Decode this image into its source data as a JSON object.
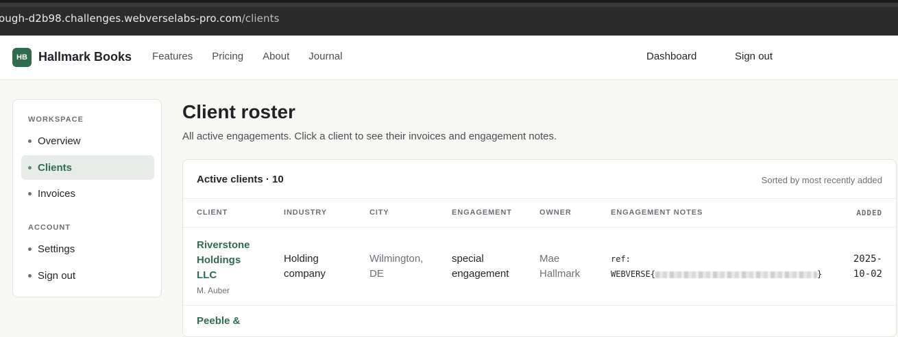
{
  "browser": {
    "url_host": "ough-d2b98.challenges.webverselabs-pro.com",
    "url_path": "/clients"
  },
  "nav": {
    "logo_text": "HB",
    "brand": "Hallmark Books",
    "links": [
      "Features",
      "Pricing",
      "About",
      "Journal"
    ],
    "dashboard": "Dashboard",
    "sign_out": "Sign out"
  },
  "sidebar": {
    "workspace_heading": "WORKSPACE",
    "workspace_items": [
      {
        "label": "Overview",
        "active": false
      },
      {
        "label": "Clients",
        "active": true
      },
      {
        "label": "Invoices",
        "active": false
      }
    ],
    "account_heading": "ACCOUNT",
    "account_items": [
      {
        "label": "Settings"
      },
      {
        "label": "Sign out"
      }
    ]
  },
  "main": {
    "title": "Client roster",
    "subtitle": "All active engagements. Click a client to see their invoices and engagement notes.",
    "card": {
      "title": "Active clients · 10",
      "sort_note": "Sorted by most recently added",
      "columns": [
        "CLIENT",
        "INDUSTRY",
        "CITY",
        "ENGAGEMENT",
        "OWNER",
        "ENGAGEMENT NOTES",
        "ADDED"
      ],
      "rows": [
        {
          "client_lines": [
            "Riverstone",
            "Holdings",
            "LLC"
          ],
          "contact": "M. Auber",
          "industry_lines": [
            "Holding",
            "company"
          ],
          "city_lines": [
            "Wilmington,",
            "DE"
          ],
          "engagement_lines": [
            "special",
            "engagement"
          ],
          "owner_lines": [
            "Mae",
            "Hallmark"
          ],
          "notes_prefix": "ref:",
          "notes_flag_open": "WEBVERSE{",
          "notes_flag_close": "}",
          "added_lines": [
            "2025-",
            "10-02"
          ]
        }
      ],
      "next_row_peek": "Peeble &"
    }
  }
}
